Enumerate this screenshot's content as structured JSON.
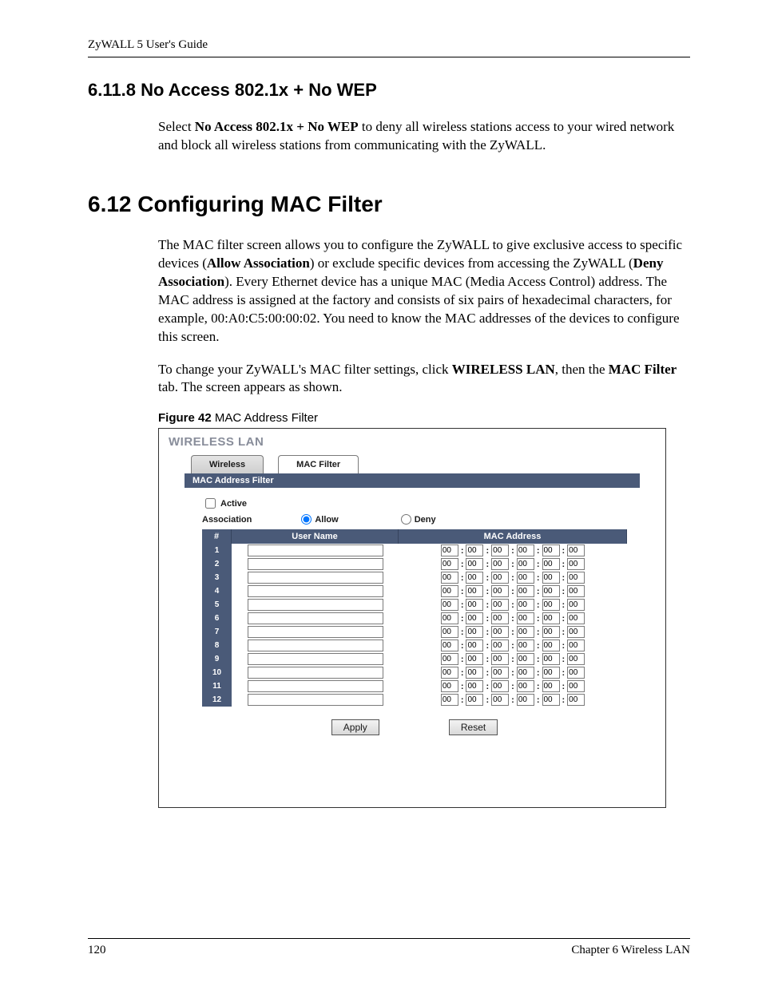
{
  "header": {
    "title": "ZyWALL 5 User's Guide"
  },
  "section_6_11_8": {
    "heading": "6.11.8  No Access 802.1x + No WEP",
    "para_pre": "Select ",
    "para_bold": "No Access 802.1x + No WEP",
    "para_post": " to deny all wireless stations access to your wired network and block all wireless stations from communicating with the ZyWALL."
  },
  "section_6_12": {
    "heading": "6.12  Configuring MAC Filter",
    "p1_a": "The MAC filter screen allows you to configure the ZyWALL to give exclusive access to specific devices (",
    "p1_b1": "Allow Association",
    "p1_c": ") or exclude specific devices from accessing the ZyWALL (",
    "p1_b2": "Deny Association",
    "p1_d": "). Every Ethernet device has a unique MAC (Media Access Control) address. The MAC address is assigned at the factory and consists of six pairs of hexadecimal characters, for example, 00:A0:C5:00:00:02. You need to know the MAC addresses of the devices to configure this screen.",
    "p2_a": "To change your ZyWALL's MAC filter settings, click ",
    "p2_b1": "WIRELESS LAN",
    "p2_b": ", then the ",
    "p2_b2": "MAC Filter",
    "p2_c": " tab. The screen appears as shown."
  },
  "figure": {
    "num": "Figure 42",
    "title": "   MAC Address Filter"
  },
  "screenshot": {
    "title": "WIRELESS LAN",
    "tabs": {
      "wireless": "Wireless",
      "macfilter": "MAC Filter"
    },
    "panel_title": "MAC Address Filter",
    "active_label": "Active",
    "assoc_label": "Association",
    "allow_label": "Allow",
    "deny_label": "Deny",
    "col_num": "#",
    "col_user": "User Name",
    "col_mac": "MAC Address",
    "rows": [
      1,
      2,
      3,
      4,
      5,
      6,
      7,
      8,
      9,
      10,
      11,
      12
    ],
    "mac_default": "00",
    "apply": "Apply",
    "reset": "Reset"
  },
  "footer": {
    "page": "120",
    "chapter": "Chapter 6 Wireless LAN"
  }
}
